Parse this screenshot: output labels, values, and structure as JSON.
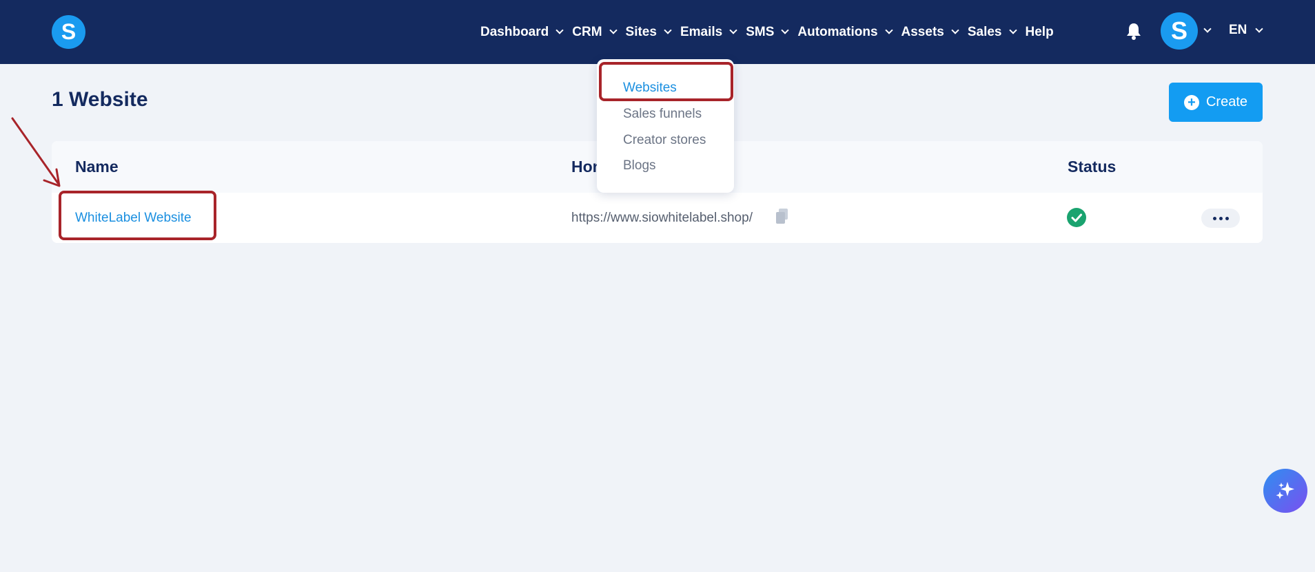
{
  "brand": {
    "logo_letter": "S",
    "accent": "#139cf2",
    "nav_bg": "#142a5f"
  },
  "nav": {
    "items": [
      {
        "label": "Dashboard",
        "has_menu": true
      },
      {
        "label": "CRM",
        "has_menu": true
      },
      {
        "label": "Sites",
        "has_menu": true
      },
      {
        "label": "Emails",
        "has_menu": true
      },
      {
        "label": "SMS",
        "has_menu": true
      },
      {
        "label": "Automations",
        "has_menu": true
      },
      {
        "label": "Assets",
        "has_menu": true
      },
      {
        "label": "Sales",
        "has_menu": true
      },
      {
        "label": "Help",
        "has_menu": false
      }
    ],
    "bell_icon": "bell-icon",
    "avatar_letter": "S",
    "language": "EN"
  },
  "sites_menu": {
    "items": [
      "Websites",
      "Sales funnels",
      "Creator stores",
      "Blogs"
    ],
    "active": "Websites"
  },
  "page": {
    "title": "1 Website",
    "create_label": "Create"
  },
  "table": {
    "headers": [
      "Name",
      "Hon",
      "Status"
    ],
    "rows": [
      {
        "name": "WhiteLabel Website",
        "host": "https://www.siowhitelabel.shop/",
        "status": "active"
      }
    ]
  },
  "annotations": {
    "color": "#a8242a"
  }
}
